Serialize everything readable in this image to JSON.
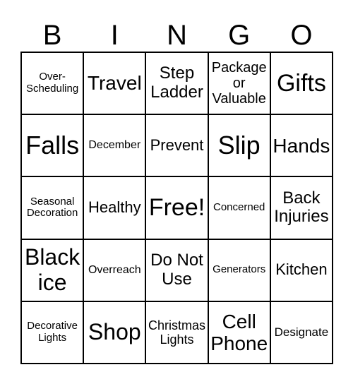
{
  "header": {
    "letters": [
      "B",
      "I",
      "N",
      "G",
      "O"
    ]
  },
  "cells": [
    "Over-Scheduling",
    "Travel",
    "Step Ladder",
    "Package or Valuable",
    "Gifts",
    "Falls",
    "December",
    "Prevent",
    "Slip",
    "Hands",
    "Seasonal Decoration",
    "Healthy",
    "Free!",
    "Concerned",
    "Back Injuries",
    "Black ice",
    "Overreach",
    "Do Not Use",
    "Generators",
    "Kitchen",
    "Decorative Lights",
    "Shop",
    "Christmas Lights",
    "Cell Phone",
    "Designate"
  ]
}
